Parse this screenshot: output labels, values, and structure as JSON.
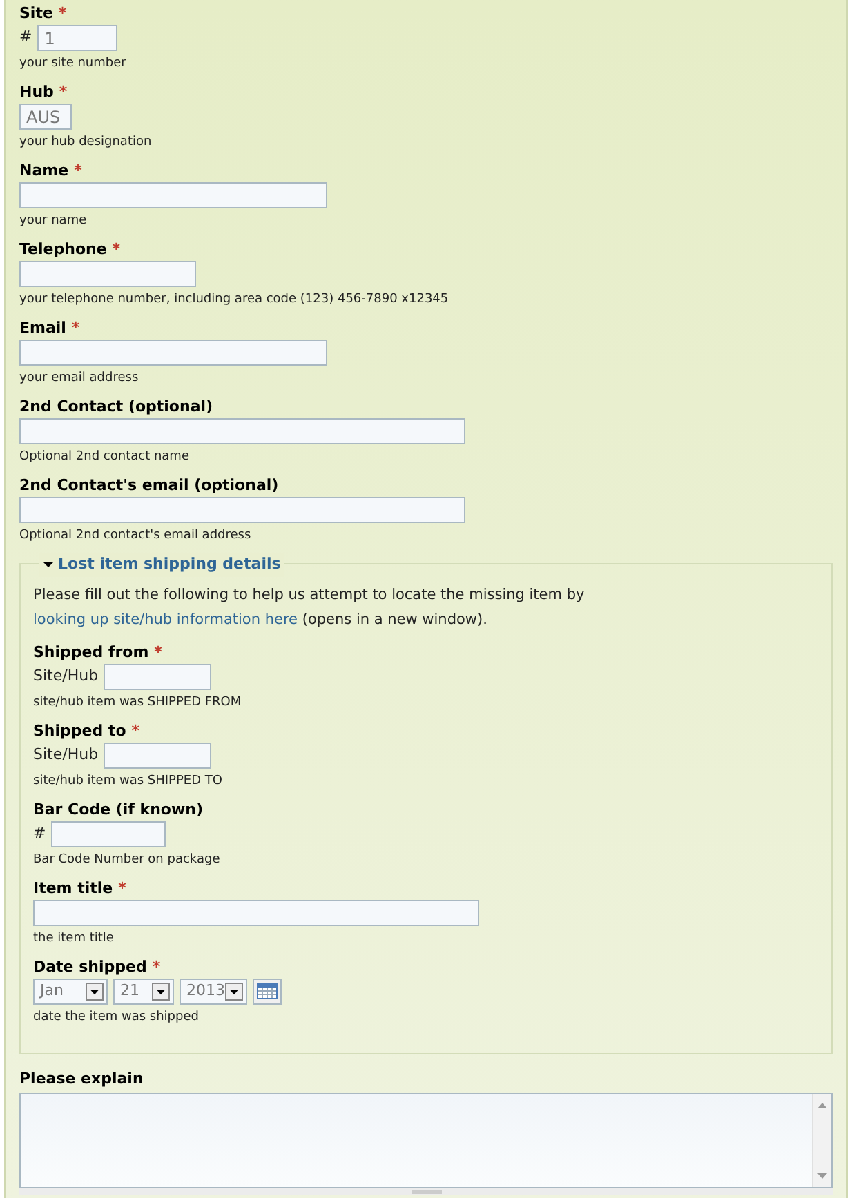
{
  "fields": [
    {
      "label": "Site",
      "required_mark": "*",
      "prefix": "#",
      "value": "1",
      "help": "your site number"
    },
    {
      "label": "Hub",
      "required_mark": "*",
      "value": "AUS",
      "help": "your hub designation"
    },
    {
      "label": "Name",
      "required_mark": "*",
      "help": "your name"
    },
    {
      "label": "Telephone",
      "required_mark": "*",
      "help": "your telephone number, including area code (123) 456-7890 x12345"
    },
    {
      "label": "Email",
      "required_mark": "*",
      "help": "your email address"
    },
    {
      "label": "2nd Contact (optional)",
      "help": "Optional 2nd contact name"
    },
    {
      "label": "2nd Contact's email (optional)",
      "help": "Optional 2nd contact's email address"
    }
  ],
  "fieldset": {
    "legend": "Lost item shipping details",
    "expanded": true,
    "intro": {
      "before": "Please fill out the following to help us attempt to locate the missing item by",
      "link": "looking up site/hub information here",
      "after": "(opens in a new window)."
    },
    "fields": [
      {
        "kind": "text",
        "label": "Shipped from",
        "required_mark": "*",
        "prefix": "Site/Hub",
        "help": "site/hub item was SHIPPED FROM"
      },
      {
        "kind": "text",
        "label": "Shipped to",
        "required_mark": "*",
        "prefix": "Site/Hub",
        "help": "site/hub item was SHIPPED TO"
      },
      {
        "kind": "text",
        "label": "Bar Code (if known)",
        "prefix": "#",
        "help": "Bar Code Number on package"
      },
      {
        "kind": "text",
        "label": "Item title",
        "required_mark": "*",
        "help": "the item title"
      },
      {
        "kind": "date",
        "label": "Date shipped",
        "required_mark": "*",
        "month": "Jan",
        "day": "21",
        "year": "2013",
        "help": "date the item was shipped"
      }
    ]
  },
  "explain": {
    "label": "Please explain"
  }
}
